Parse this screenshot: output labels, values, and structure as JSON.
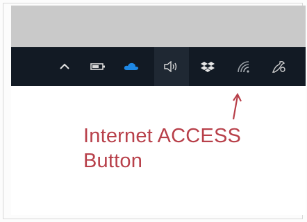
{
  "taskbar": {
    "icons": [
      {
        "name": "chevron-up-icon",
        "color": "#e6e6e6"
      },
      {
        "name": "battery-icon",
        "color": "#d9d9d9"
      },
      {
        "name": "onedrive-cloud-icon",
        "color": "#1e88e5"
      },
      {
        "name": "volume-icon",
        "color": "#d9d9d9"
      },
      {
        "name": "dropbox-icon",
        "color": "#e6e6e6"
      },
      {
        "name": "wifi-icon",
        "color": "#9aa0a6"
      },
      {
        "name": "pen-workspace-icon",
        "color": "#cfcfcf"
      }
    ]
  },
  "annotation": {
    "line1": "Internet ACCESS",
    "line2": "Button",
    "color": "#b8404a"
  }
}
